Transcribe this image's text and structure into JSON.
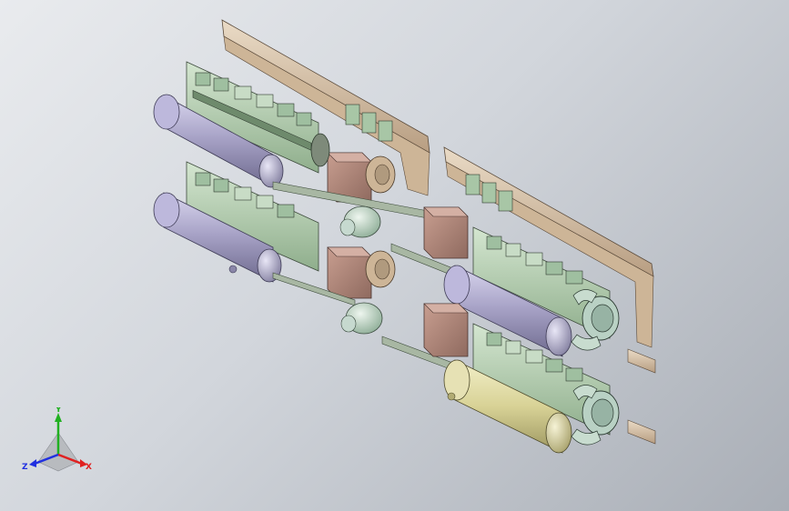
{
  "viewport": {
    "background_top": "#e9ebee",
    "background_bottom": "#a9aeb6",
    "model": {
      "description_colors": {
        "tank_purple": "#a9a4c8",
        "tank_yellow": "#dcd79c",
        "engine_green": "#b7cfb4",
        "block_brown": "#b58a7c",
        "frame_tan": "#d8bfa3",
        "shaft_grey": "#a8b7a3",
        "coupling_teal": "#c6d9cf"
      }
    }
  },
  "triad": {
    "x_label": "X",
    "y_label": "Y",
    "z_label": "Z",
    "x_color": "#e02020",
    "y_color": "#20b020",
    "z_color": "#2030e0"
  }
}
